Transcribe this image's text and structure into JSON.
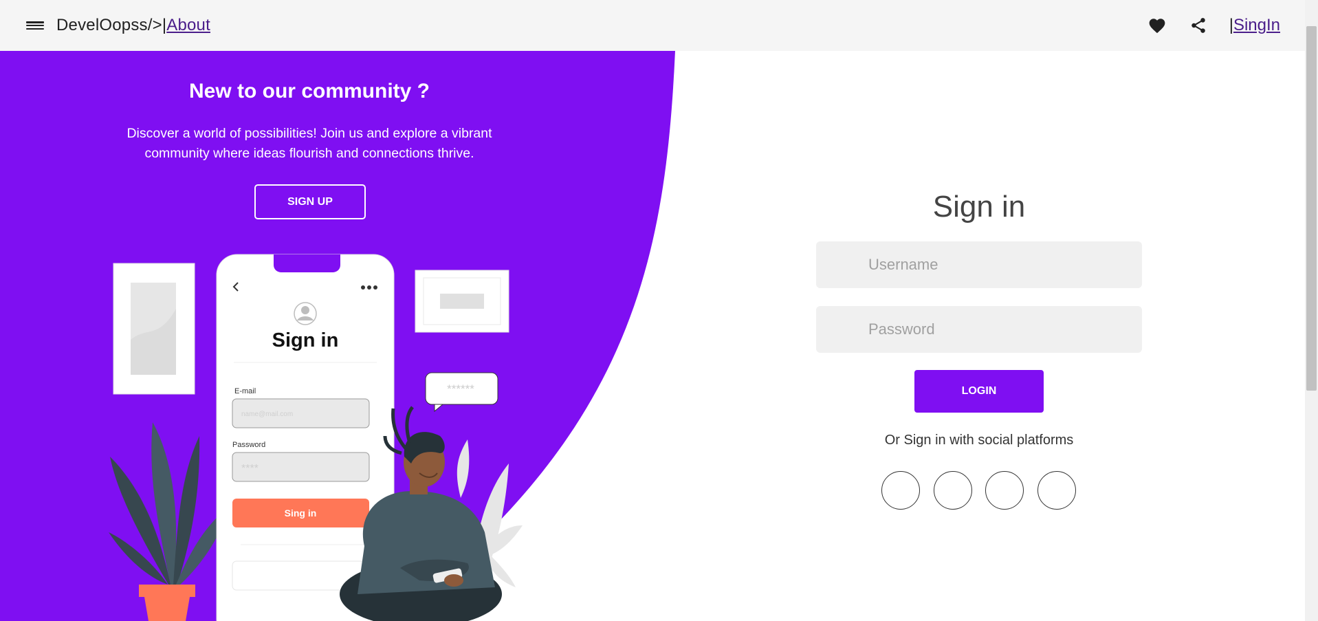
{
  "header": {
    "brand": "DevelOopss/>",
    "brand_separator": "|",
    "about_link": "About",
    "signin_separator": "|",
    "signin_link": "SingIn"
  },
  "left_panel": {
    "title": "New to our community ?",
    "description": "Discover a world of possibilities! Join us and explore a vibrant community where ideas flourish and connections thrive.",
    "signup_button": "SIGN UP",
    "illustration": {
      "phone_title": "Sign in",
      "email_label": "E-mail",
      "email_placeholder": "name@mail.com",
      "password_label": "Password",
      "password_value": "****",
      "phone_button": "Sing in",
      "bubble_text": "******"
    }
  },
  "signin_form": {
    "title": "Sign in",
    "username_placeholder": "Username",
    "password_placeholder": "Password",
    "login_button": "LOGIN",
    "social_text": "Or Sign in with social platforms",
    "social_buttons": [
      "",
      "",
      "",
      ""
    ]
  },
  "colors": {
    "accent": "#7f0ff2",
    "link": "#4a1d8a",
    "appbar_bg": "#f5f5f5",
    "field_bg": "#f0f0f0",
    "phone_button": "#ff7757"
  },
  "icons": {
    "menu": "menu-icon",
    "favorite": "heart-icon",
    "share": "share-icon"
  }
}
